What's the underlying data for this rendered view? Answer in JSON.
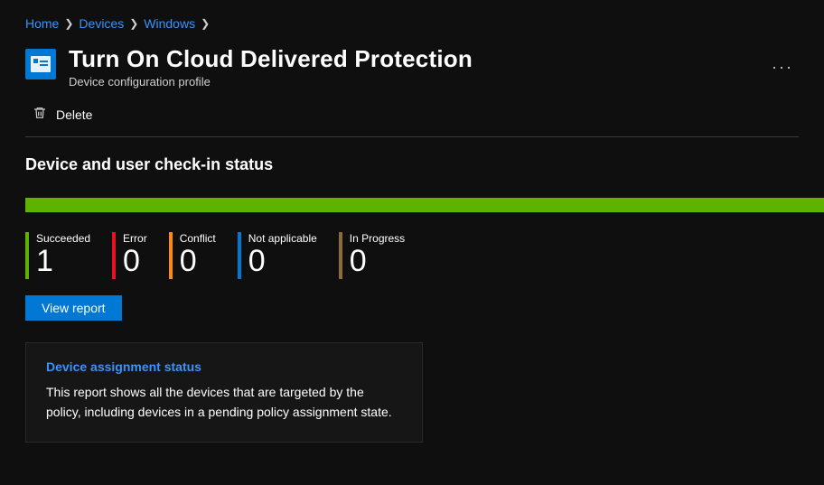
{
  "breadcrumb": {
    "items": [
      "Home",
      "Devices",
      "Windows"
    ]
  },
  "header": {
    "title": "Turn On Cloud Delivered Protection",
    "subtitle": "Device configuration profile",
    "more_label": "···"
  },
  "toolbar": {
    "delete_label": "Delete"
  },
  "section": {
    "title": "Device and user check-in status"
  },
  "stats": [
    {
      "label": "Succeeded",
      "value": "1",
      "color": "c-green"
    },
    {
      "label": "Error",
      "value": "0",
      "color": "c-red"
    },
    {
      "label": "Conflict",
      "value": "0",
      "color": "c-orange"
    },
    {
      "label": "Not applicable",
      "value": "0",
      "color": "c-blue"
    },
    {
      "label": "In Progress",
      "value": "0",
      "color": "c-olive"
    }
  ],
  "buttons": {
    "view_report": "View report"
  },
  "card": {
    "title": "Device assignment status",
    "body": "This report shows all the devices that are targeted by the policy, including devices in a pending policy assignment state."
  },
  "colors": {
    "accent": "#3794ff",
    "primary_button": "#0078d4",
    "progress": "#5db300"
  }
}
